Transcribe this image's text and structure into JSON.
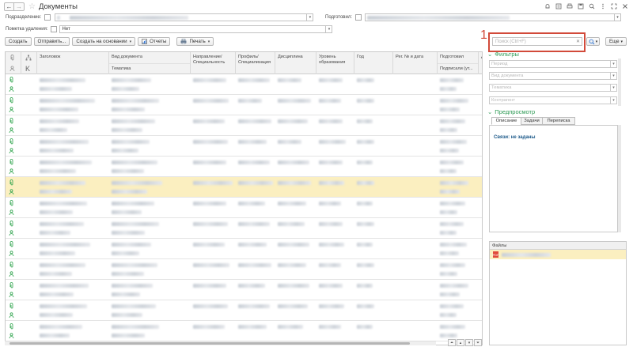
{
  "window": {
    "title": "Документы",
    "back_glyph": "←",
    "forward_glyph": "→",
    "star_glyph": "☆",
    "icons": [
      "bell-icon",
      "link-icon",
      "print-icon",
      "save-icon",
      "zoom-icon",
      "more-icon",
      "expand-icon",
      "close-icon"
    ]
  },
  "filters": {
    "division_label": "Подразделение:",
    "prepared_label": "Подготовил:",
    "deletion_label": "Пометка удаления:",
    "deletion_value": "Нет"
  },
  "toolbar": {
    "create": "Создать",
    "send": "Отправить...",
    "create_based": "Создать на основании",
    "reports": "Отчеты",
    "print": "Печать",
    "more": "Еще"
  },
  "search": {
    "placeholder": "Поиск (Ctrl+F)",
    "annotation": "1"
  },
  "grid": {
    "columns": [
      {
        "top": "Заголовок",
        "bottom": ""
      },
      {
        "top": "Вид документа",
        "bottom": "Тематика"
      },
      {
        "top": "Направление/Специальность",
        "bottom": ""
      },
      {
        "top": "Профиль/Специализация",
        "bottom": ""
      },
      {
        "top": "Дисциплина",
        "bottom": ""
      },
      {
        "top": "Уровень образования",
        "bottom": ""
      },
      {
        "top": "Год",
        "bottom": ""
      },
      {
        "top": "Рег. № и дата",
        "bottom": ""
      },
      {
        "top": "Подготовил",
        "bottom": "Подписали (ут..."
      },
      {
        "top": "Дa",
        "bottom": ""
      }
    ],
    "selected_row": 5,
    "row_count": 13
  },
  "side": {
    "filters_title": "Фильтры",
    "filter_fields": [
      "Период",
      "Вид документа",
      "Тематика",
      "Контрагент"
    ],
    "preview_title": "Предпросмотр",
    "tabs": [
      "Описание",
      "Задачи",
      "Переписка"
    ],
    "preview_message": "Связи: не заданы",
    "files_title": "Файлы",
    "pdf_label": "PDF"
  },
  "colors": {
    "accent_green": "#2f9b56",
    "selection": "#fbefc0",
    "annotation_red": "#d24a3a"
  }
}
